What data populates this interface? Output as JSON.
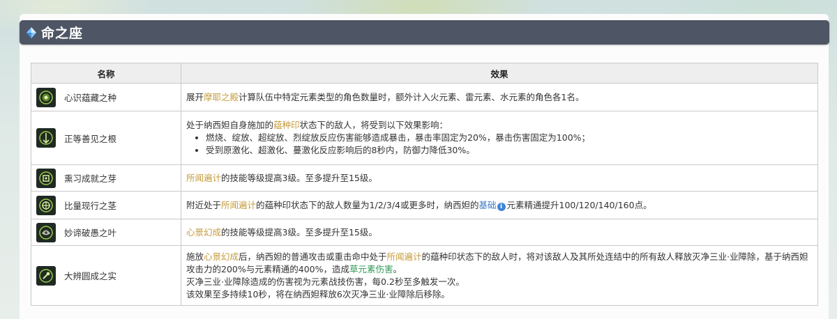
{
  "section_title": "命之座",
  "table": {
    "header_name": "名称",
    "header_effect": "效果"
  },
  "rows": [
    {
      "name": "心识蕴藏之种",
      "icon": "constellation-seed-icon",
      "e1": "展开",
      "e1_hl": "摩耶之殿",
      "e1_tail": "计算队伍中特定元素类型的角色数量时，额外计入火元素、雷元素、水元素的角色各1名。"
    },
    {
      "name": "正等善见之根",
      "icon": "constellation-root-icon",
      "intro_a": "处于纳西妲自身施加的",
      "intro_hl": "蕴种印",
      "intro_b": "状态下的敌人，将受到以下效果影响：",
      "bullets": [
        "燃烧、绽放、超绽放、烈绽放反应伤害能够造成暴击，暴击率固定为20%，暴击伤害固定为100%；",
        "受到原激化、超激化、蔓激化反应影响后的8秒内，防御力降低30%。"
      ]
    },
    {
      "name": "熏习成就之芽",
      "icon": "constellation-sprout-icon",
      "hl": "所闻遍计",
      "tail": "的技能等级提高3级。至多提升至15级。"
    },
    {
      "name": "比量现行之茎",
      "icon": "constellation-stem-icon",
      "a": "附近处于",
      "hl": "所闻遍计",
      "b": "的蕴种印状态下的敌人数量为1/2/3/4或更多时，纳西妲的",
      "link": "基础",
      "info_glyph": "i",
      "c": "元素精通提升100/120/140/160点。"
    },
    {
      "name": "妙谛破愚之叶",
      "icon": "constellation-leaf-icon",
      "hl": "心景幻成",
      "tail": "的技能等级提高3级。至多提升至15级。"
    },
    {
      "name": "大辨圆成之实",
      "icon": "constellation-fruit-icon",
      "p1_a": "施放",
      "p1_hl1": "心景幻成",
      "p1_b": "后，纳西妲的普通攻击或重击命中处于",
      "p1_hl2": "所闻遍计",
      "p1_c": "的蕴种印状态下的敌人时，将对该敌人及其所处连结中的所有敌人释放灭净三业·业障除，基于纳西妲攻击力的200%与元素精通的400%，造成",
      "p1_hl3": "草元素伤害",
      "p1_d": "。",
      "p2": "灭净三业·业障除造成的伤害视为元素战技伤害，每0.2秒至多触发一次。",
      "p3": "该效果至多持续10秒，将在纳西妲释放6次灭净三业·业障除后移除。"
    }
  ],
  "colors": {
    "header_bg": "#4e5564",
    "highlight_gold": "#c59b3d",
    "highlight_green": "#2f9a58",
    "link_blue": "#3a79c7"
  }
}
